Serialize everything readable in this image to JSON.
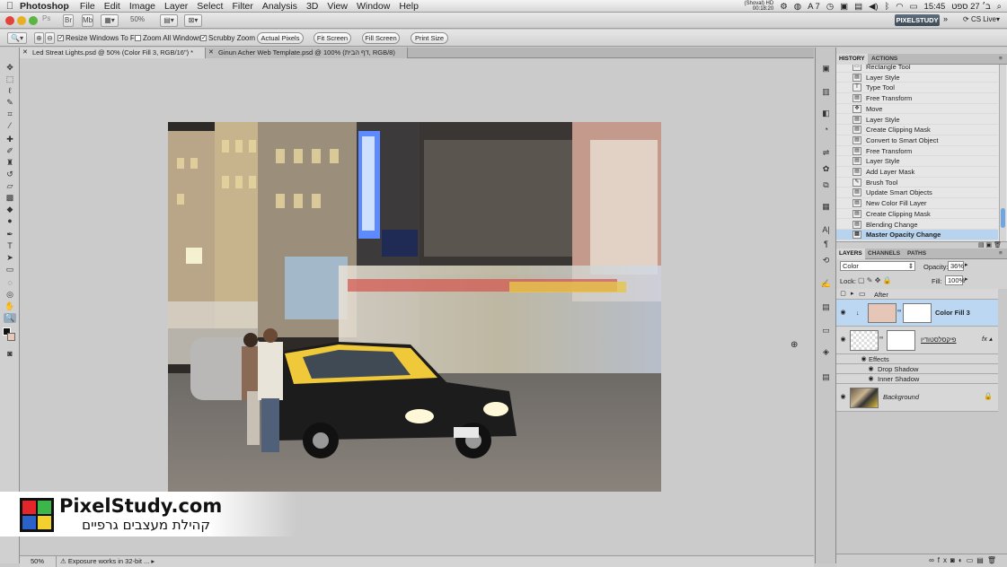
{
  "menubar": {
    "app": "Photoshop",
    "items": [
      "File",
      "Edit",
      "Image",
      "Layer",
      "Select",
      "Filter",
      "Analysis",
      "3D",
      "View",
      "Window",
      "Help"
    ],
    "status_top": "(Shoval) HD",
    "status_bottom": "00:18:20",
    "layout_indicator": "A 7",
    "clock": "15:45",
    "date": "ב׳ 27 ספט"
  },
  "appbar": {
    "ps_label": "Ps",
    "br_label": "Br",
    "mb_label": "Mb",
    "zoom": "50%",
    "workspace": "PIXELSTUDY",
    "cs_live": "CS Live"
  },
  "options": {
    "resize_windows_label": "Resize Windows To Fit",
    "zoom_all_windows_label": "Zoom All Windows",
    "scrubby_zoom_label": "Scrubby Zoom",
    "buttons": [
      "Actual Pixels",
      "Fit Screen",
      "Fill Screen",
      "Print Size"
    ]
  },
  "tabs": [
    {
      "label": "Led Streat Lights.psd @ 50% (Color Fill 3, RGB/16\") *",
      "active": true
    },
    {
      "label": "Ginun Acher Web Template.psd @ 100% (דף הבית, RGB/8)",
      "active": false
    }
  ],
  "watermark": {
    "title": "PixelStudy.com",
    "subtitle": "קהילת מעצבים גרפיים"
  },
  "status": {
    "zoom": "50%",
    "info": "Exposure works in 32-bit ..."
  },
  "history": {
    "tabs": [
      "HISTORY",
      "ACTIONS"
    ],
    "items": [
      {
        "label": "Rectangle Tool",
        "icon": "rect"
      },
      {
        "label": "Layer Style",
        "icon": "doc"
      },
      {
        "label": "Type Tool",
        "icon": "T"
      },
      {
        "label": "Free Transform",
        "icon": "doc"
      },
      {
        "label": "Move",
        "icon": "move"
      },
      {
        "label": "Layer Style",
        "icon": "doc"
      },
      {
        "label": "Create Clipping Mask",
        "icon": "doc"
      },
      {
        "label": "Convert to Smart Object",
        "icon": "doc"
      },
      {
        "label": "Free Transform",
        "icon": "doc"
      },
      {
        "label": "Layer Style",
        "icon": "doc"
      },
      {
        "label": "Add Layer Mask",
        "icon": "doc"
      },
      {
        "label": "Brush Tool",
        "icon": "brush"
      },
      {
        "label": "Update Smart Objects",
        "icon": "doc"
      },
      {
        "label": "New Color Fill Layer",
        "icon": "doc"
      },
      {
        "label": "Create Clipping Mask",
        "icon": "doc"
      },
      {
        "label": "Blending Change",
        "icon": "doc"
      },
      {
        "label": "Master Opacity Change",
        "icon": "doc"
      }
    ]
  },
  "layers": {
    "tabs": [
      "LAYERS",
      "CHANNELS",
      "PATHS"
    ],
    "blend_mode": "Color",
    "opacity_label": "Opacity:",
    "opacity": "36%",
    "lock_label": "Lock:",
    "fill_label": "Fill:",
    "fill": "100%",
    "group_name": "After",
    "color_fill_name": "Color Fill 3",
    "smart_layer_name": "פיקסלסטודיו",
    "effects_label": "Effects",
    "effects": [
      "Drop Shadow",
      "Inner Shadow"
    ],
    "background_name": "Background",
    "colors": {
      "fill_swatch": "#e6c7b7",
      "selection": "#bcd7f2"
    }
  }
}
